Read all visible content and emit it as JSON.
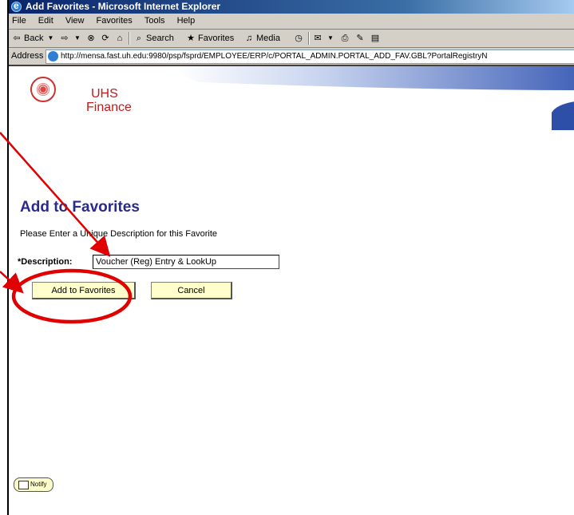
{
  "window": {
    "title": "Add Favorites - Microsoft Internet Explorer"
  },
  "menu": [
    "File",
    "Edit",
    "View",
    "Favorites",
    "Tools",
    "Help"
  ],
  "toolbar": {
    "back_label": "Back",
    "search_label": "Search",
    "favorites_label": "Favorites",
    "media_label": "Media"
  },
  "address": {
    "label": "Address",
    "url": "http://mensa.fast.uh.edu:9980/psp/fsprd/EMPLOYEE/ERP/c/PORTAL_ADMIN.PORTAL_ADD_FAV.GBL?PortalRegistryN"
  },
  "brand": {
    "line1": "UHS",
    "line2": "Finance"
  },
  "form": {
    "title": "Add to Favorites",
    "instruction": "Please Enter a Unique Description for this Favorite",
    "description_label": "*Description:",
    "description_value": "Voucher (Reg) Entry & LookUp",
    "add_button": "Add to Favorites",
    "cancel_button": "Cancel"
  },
  "notify": {
    "label": "Notify"
  },
  "colors": {
    "title_bar": "#0a246a",
    "brand_red": "#c21a1a",
    "heading_blue": "#2a2a8c",
    "button_fill": "#ffffcc",
    "annotation_red": "#e00000"
  }
}
